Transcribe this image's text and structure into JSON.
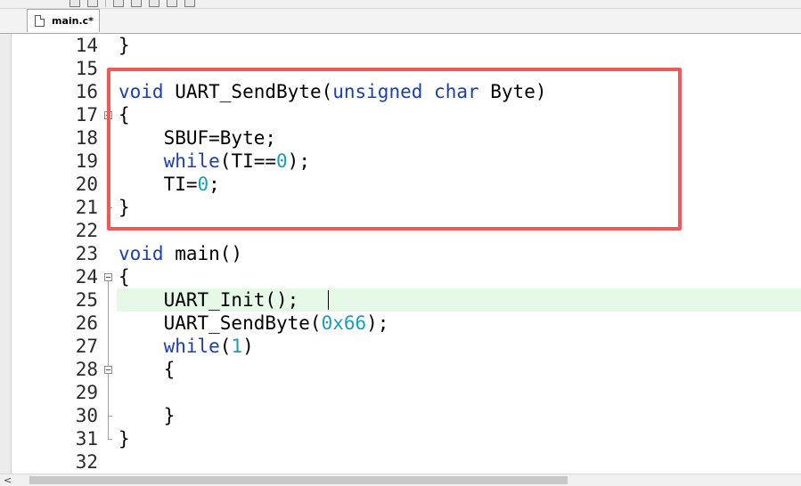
{
  "tab": {
    "label": "main.c*"
  },
  "lines": [
    {
      "n": "14",
      "code": "}"
    },
    {
      "n": "15",
      "code": ""
    },
    {
      "n": "16",
      "code": "void UART_SendByte(unsigned char Byte)"
    },
    {
      "n": "17",
      "code": "{"
    },
    {
      "n": "18",
      "code": "    SBUF=Byte;"
    },
    {
      "n": "19",
      "code": "    while(TI==0);"
    },
    {
      "n": "20",
      "code": "    TI=0;"
    },
    {
      "n": "21",
      "code": "}"
    },
    {
      "n": "22",
      "code": ""
    },
    {
      "n": "23",
      "code": "void main()"
    },
    {
      "n": "24",
      "code": "{"
    },
    {
      "n": "25",
      "code": "    UART_Init();"
    },
    {
      "n": "26",
      "code": "    UART_SendByte(0x66);"
    },
    {
      "n": "27",
      "code": "    while(1)"
    },
    {
      "n": "28",
      "code": "    {"
    },
    {
      "n": "29",
      "code": ""
    },
    {
      "n": "30",
      "code": "    }"
    },
    {
      "n": "31",
      "code": "}"
    },
    {
      "n": "32",
      "code": ""
    }
  ],
  "current_line": "25",
  "colors": {
    "keyword": "#1a3fb0",
    "number": "#1aa0b4",
    "highlight": "#ee5a5a",
    "current_line_bg": "#e6f8e6"
  },
  "scrollbar": {
    "left_arrow": "<"
  }
}
